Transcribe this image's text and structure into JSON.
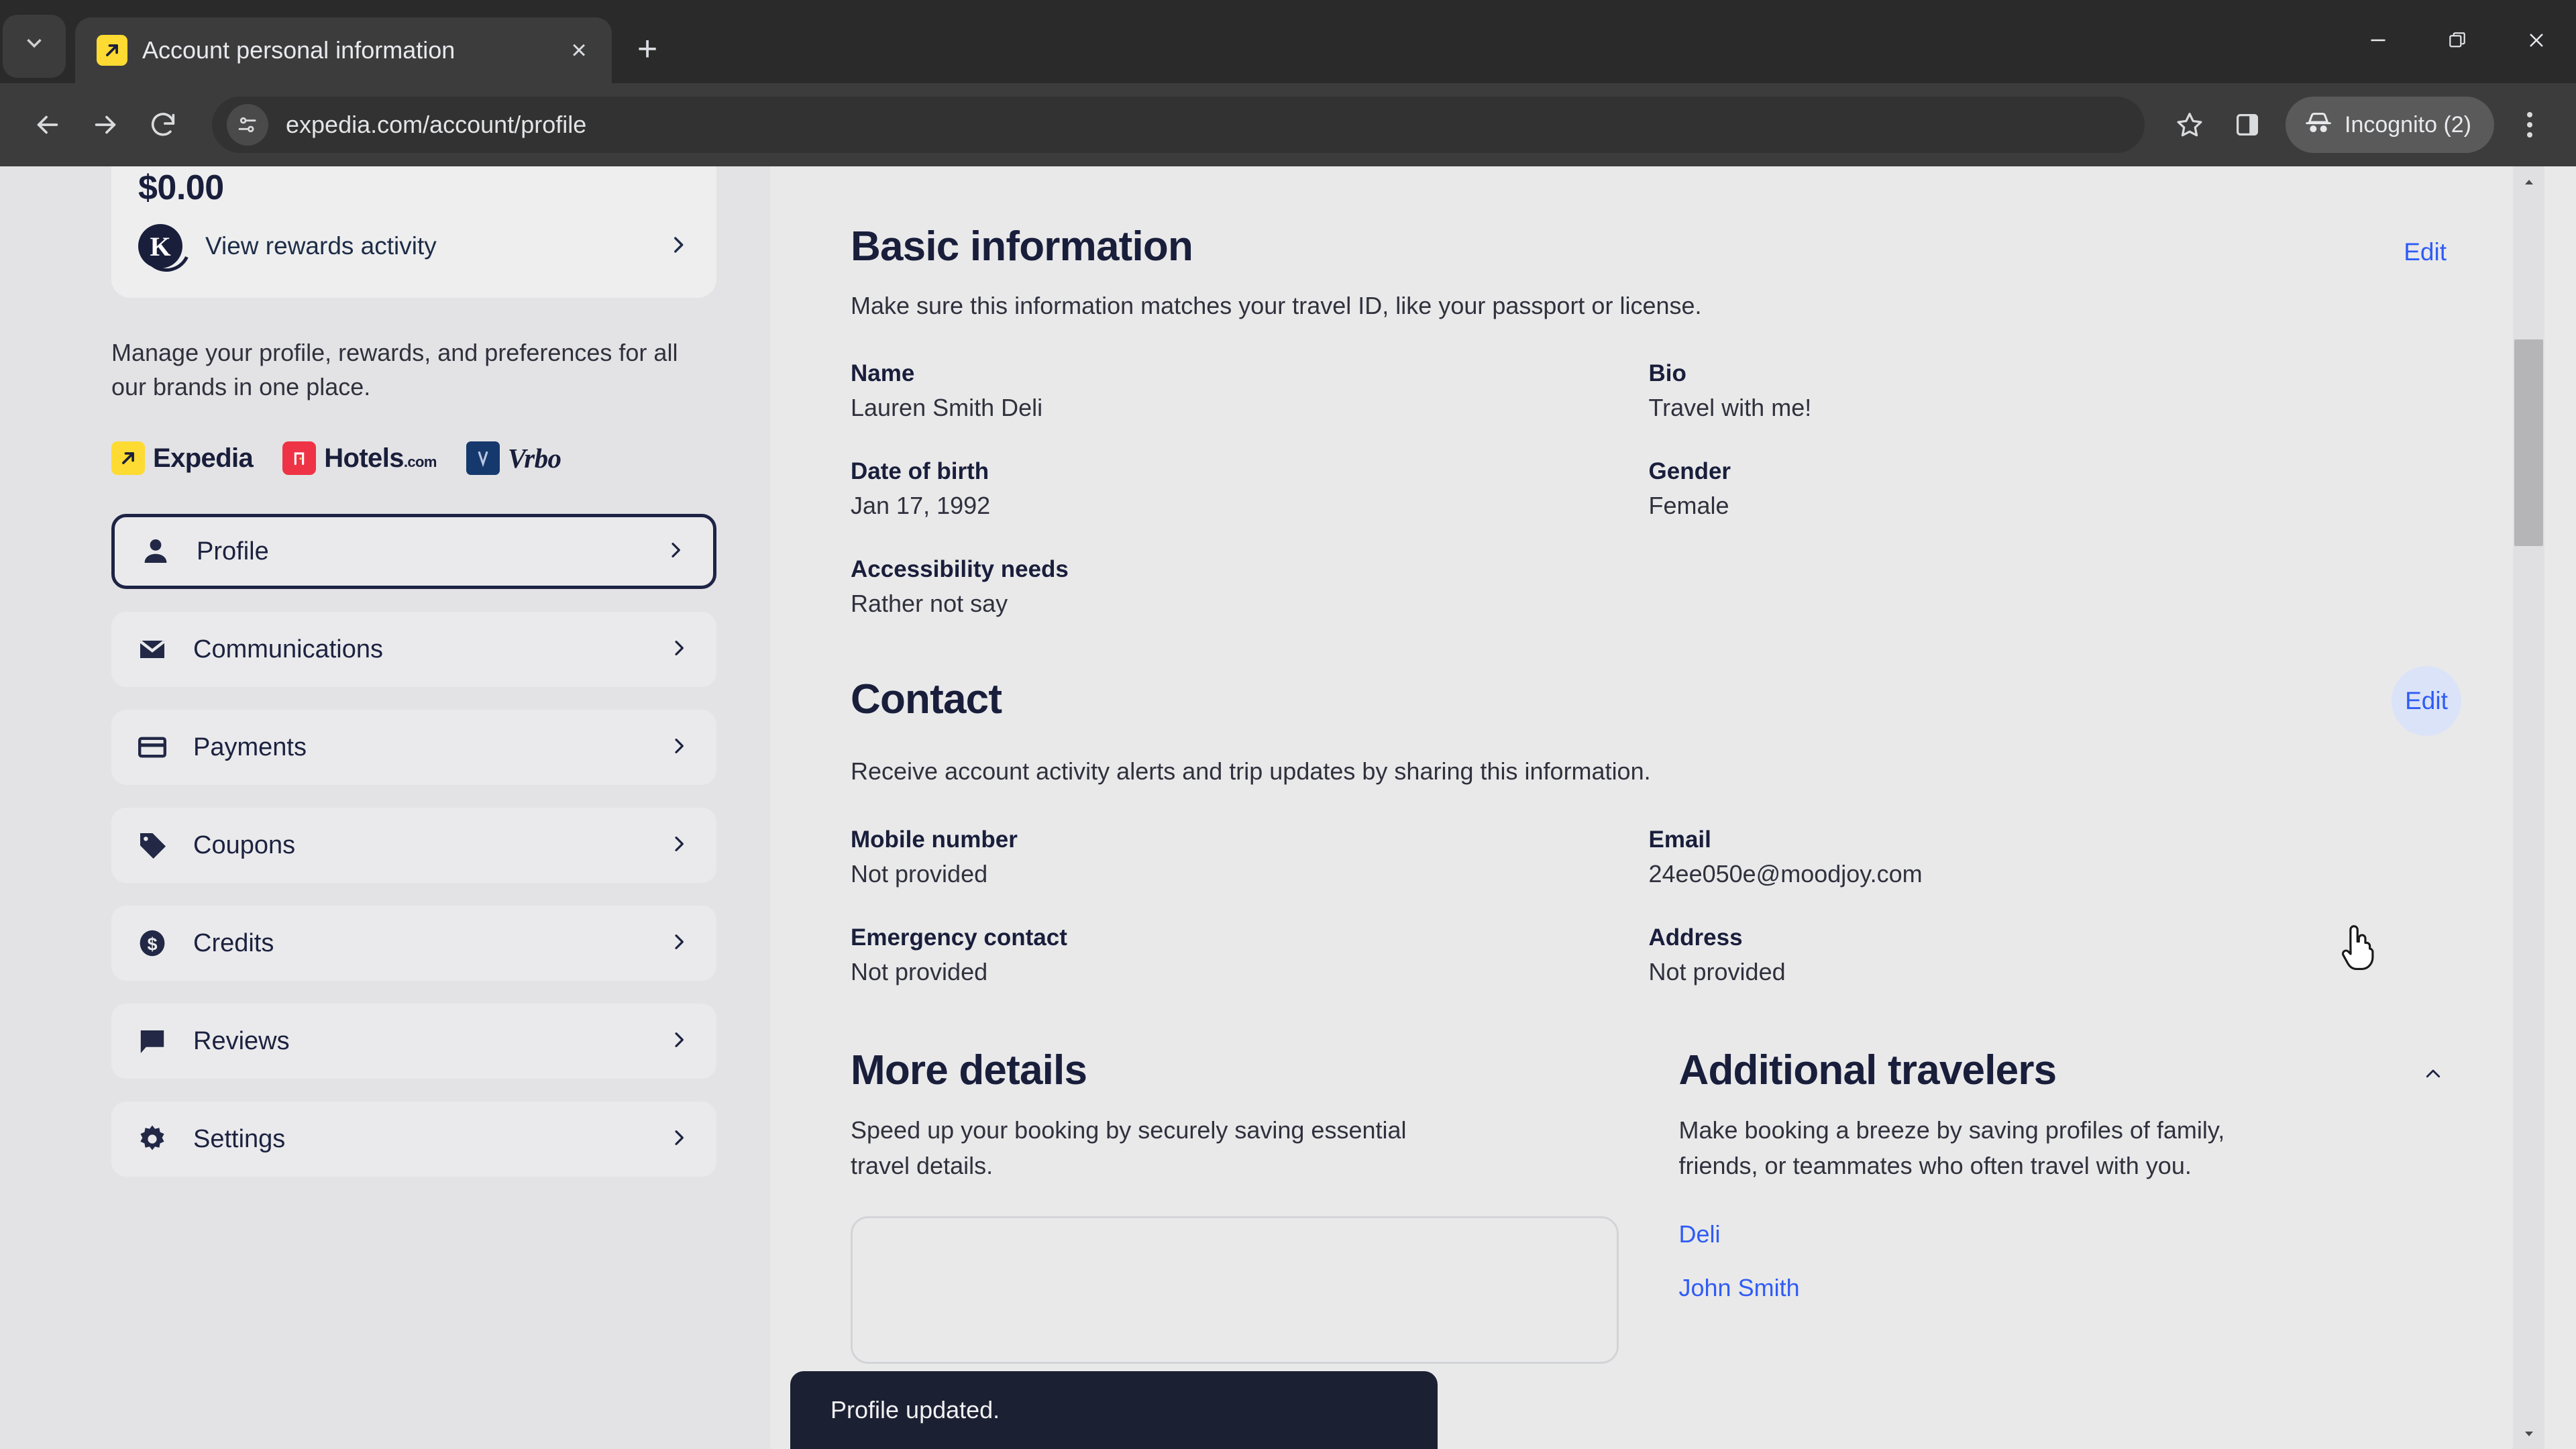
{
  "browser": {
    "tab": {
      "title": "Account personal information",
      "favicon": "expedia-favicon"
    },
    "tab_list_icon": "chevron-down-icon",
    "new_tab_label": "+",
    "close_tab_label": "×",
    "nav": {
      "back": "back-arrow",
      "forward": "forward-arrow",
      "reload": "reload-icon"
    },
    "omnibox": {
      "url": "expedia.com/account/profile",
      "site_icon": "site-settings-icon"
    },
    "actions": {
      "bookmark": "star-icon",
      "side_panel": "side-panel-icon",
      "menu": "three-dots-icon"
    },
    "profile": {
      "label": "Incognito (2)",
      "icon": "incognito-icon"
    },
    "window": {
      "minimize": "minimize-icon",
      "restore": "restore-icon",
      "close": "close-icon"
    }
  },
  "sidebar": {
    "rewards": {
      "amount": "$0.00",
      "link_label": "View rewards activity",
      "logo_letter": "K"
    },
    "description": "Manage your profile, rewards, and preferences for all our brands in one place.",
    "brands": [
      {
        "name": "Expedia",
        "suffix": ""
      },
      {
        "name": "Hotels",
        "suffix": ".com"
      },
      {
        "name": "Vrbo",
        "suffix": ""
      }
    ],
    "items": [
      {
        "label": "Profile",
        "icon": "person-icon",
        "active": true
      },
      {
        "label": "Communications",
        "icon": "envelope-icon",
        "active": false
      },
      {
        "label": "Payments",
        "icon": "credit-card-icon",
        "active": false
      },
      {
        "label": "Coupons",
        "icon": "tag-icon",
        "active": false
      },
      {
        "label": "Credits",
        "icon": "dollar-coin-icon",
        "active": false
      },
      {
        "label": "Reviews",
        "icon": "speech-bubble-icon",
        "active": false
      },
      {
        "label": "Settings",
        "icon": "gear-icon",
        "active": false
      }
    ]
  },
  "main": {
    "basic_information": {
      "title": "Basic information",
      "edit_label": "Edit",
      "subtitle": "Make sure this information matches your travel ID, like your passport or license.",
      "fields": [
        {
          "label": "Name",
          "value": "Lauren Smith Deli"
        },
        {
          "label": "Bio",
          "value": "Travel with me!"
        },
        {
          "label": "Date of birth",
          "value": "Jan 17, 1992"
        },
        {
          "label": "Gender",
          "value": "Female"
        },
        {
          "label": "Accessibility needs",
          "value": "Rather not say"
        }
      ]
    },
    "contact": {
      "title": "Contact",
      "edit_label": "Edit",
      "subtitle": "Receive account activity alerts and trip updates by sharing this information.",
      "fields": [
        {
          "label": "Mobile number",
          "value": "Not provided"
        },
        {
          "label": "Email",
          "value": "24ee050e@moodjoy.com"
        },
        {
          "label": "Emergency contact",
          "value": "Not provided"
        },
        {
          "label": "Address",
          "value": "Not provided"
        }
      ]
    },
    "more_details": {
      "title": "More details",
      "subtitle": "Speed up your booking by securely saving essential travel details."
    },
    "additional_travelers": {
      "title": "Additional travelers",
      "collapse_icon": "chevron-up-icon",
      "subtitle": "Make booking a breeze by saving profiles of family, friends, or teammates who often travel with you.",
      "travelers": [
        {
          "name": "Deli"
        },
        {
          "name": "John Smith"
        }
      ]
    }
  },
  "toast": {
    "message": "Profile updated."
  },
  "colors": {
    "accent_link": "#2f5cf6",
    "brand_navy": "#191e3b",
    "page_bg": "#e9e9ea",
    "sidebar_bg": "#e3e3e5",
    "toast_bg": "#1c2033",
    "expedia_yellow": "#fddb32",
    "hotels_red": "#ef3346",
    "vrbo_blue": "#16396d"
  }
}
